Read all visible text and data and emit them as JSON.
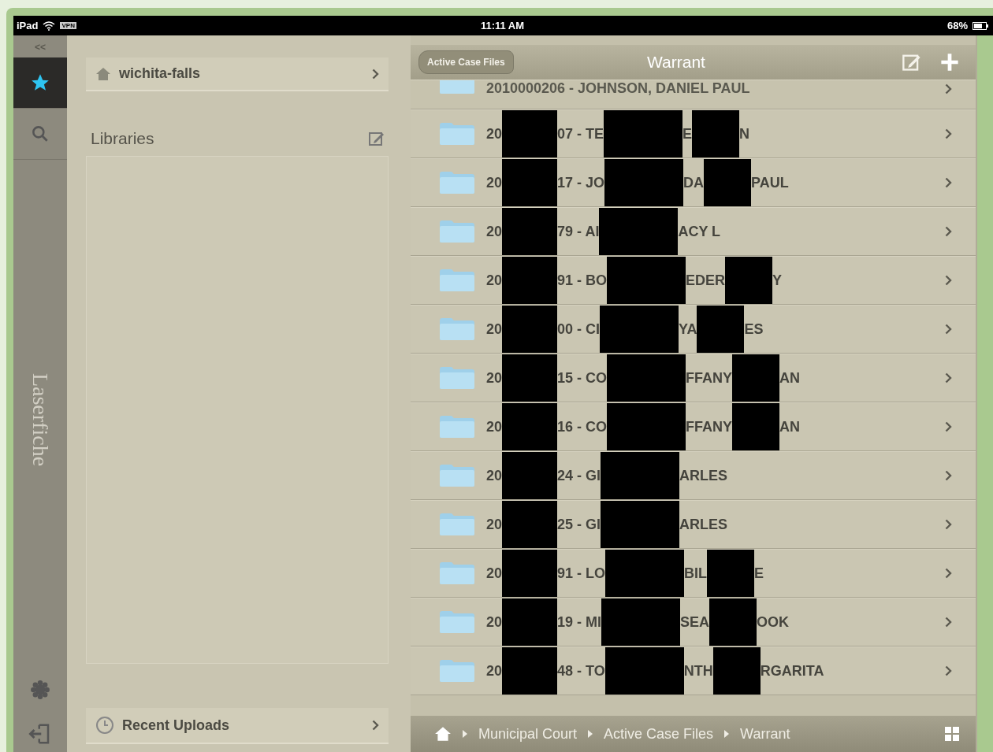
{
  "status_bar": {
    "device": "iPad",
    "vpn": "VPN",
    "time": "11:11 AM",
    "battery": "68%"
  },
  "rail": {
    "collapse": "<<",
    "brand": "Laserfiche",
    "items": [
      {
        "kind": "favorites",
        "selected": true
      },
      {
        "kind": "search",
        "selected": false
      }
    ]
  },
  "left_panel": {
    "repository": "wichita-falls",
    "libraries_title": "Libraries",
    "recent": "Recent Uploads"
  },
  "nav_bar": {
    "back": "Active Case Files",
    "title": "Warrant"
  },
  "rows": [
    {
      "parts": [
        "2010000206 - JOHNSON, DANIEL PAUL"
      ],
      "partial": true
    },
    {
      "parts": [
        "20",
        "07 - TE",
        "E",
        "N"
      ],
      "partial": false
    },
    {
      "parts": [
        "20",
        "17 - JO",
        "DA",
        "PAUL"
      ],
      "partial": false
    },
    {
      "parts": [
        "20",
        "79 - AI",
        "ACY L"
      ],
      "partial": false
    },
    {
      "parts": [
        "20",
        "91 - BO",
        "EDER",
        "Y"
      ],
      "partial": false
    },
    {
      "parts": [
        "20",
        "00 - CI",
        "YA",
        "ES"
      ],
      "partial": false
    },
    {
      "parts": [
        "20",
        "15 - CO",
        "FFANY",
        "AN"
      ],
      "partial": false
    },
    {
      "parts": [
        "20",
        "16 - CO",
        "FFANY",
        "AN"
      ],
      "partial": false
    },
    {
      "parts": [
        "20",
        "24 - GI",
        "ARLES"
      ],
      "partial": false
    },
    {
      "parts": [
        "20",
        "25 - GI",
        "ARLES"
      ],
      "partial": false
    },
    {
      "parts": [
        "20",
        "91 - LO",
        "BIL",
        "E"
      ],
      "partial": false
    },
    {
      "parts": [
        "20",
        "19 - MI",
        "SEA",
        "OOK"
      ],
      "partial": false
    },
    {
      "parts": [
        "20",
        "48 - TO",
        "NTH",
        "RGARITA"
      ],
      "partial": false
    }
  ],
  "breadcrumb": [
    "Municipal Court",
    "Active Case Files",
    "Warrant"
  ]
}
